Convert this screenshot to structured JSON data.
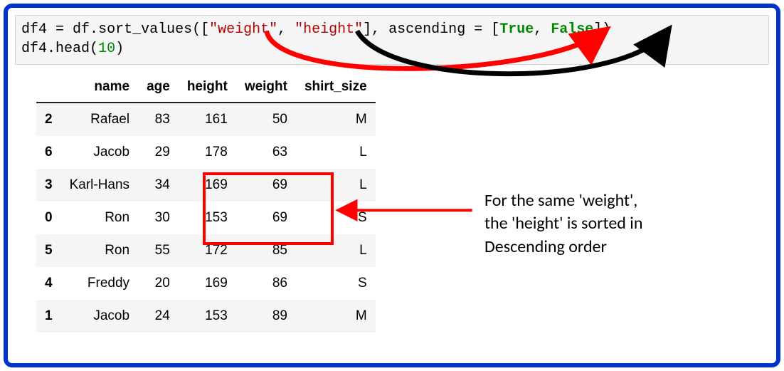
{
  "code": {
    "var": "df4",
    "obj": "df",
    "method": "sort_values",
    "arg1": "\"weight\"",
    "arg2": "\"height\"",
    "kw": "ascending",
    "bool1": "True",
    "bool2": "False",
    "line2_obj": "df4",
    "line2_method": "head",
    "line2_arg": "10"
  },
  "table": {
    "headers": {
      "name": "name",
      "age": "age",
      "height": "height",
      "weight": "weight",
      "shirt_size": "shirt_size"
    },
    "rows": [
      {
        "idx": "2",
        "name": "Rafael",
        "age": "83",
        "height": "161",
        "weight": "50",
        "shirt_size": "M"
      },
      {
        "idx": "6",
        "name": "Jacob",
        "age": "29",
        "height": "178",
        "weight": "63",
        "shirt_size": "L"
      },
      {
        "idx": "3",
        "name": "Karl-Hans",
        "age": "34",
        "height": "169",
        "weight": "69",
        "shirt_size": "L"
      },
      {
        "idx": "0",
        "name": "Ron",
        "age": "30",
        "height": "153",
        "weight": "69",
        "shirt_size": "S"
      },
      {
        "idx": "5",
        "name": "Ron",
        "age": "55",
        "height": "172",
        "weight": "85",
        "shirt_size": "L"
      },
      {
        "idx": "4",
        "name": "Freddy",
        "age": "20",
        "height": "169",
        "weight": "86",
        "shirt_size": "S"
      },
      {
        "idx": "1",
        "name": "Jacob",
        "age": "24",
        "height": "153",
        "weight": "89",
        "shirt_size": "M"
      }
    ]
  },
  "annotation": {
    "line1": "For the same 'weight',",
    "line2": "the 'height' is sorted in",
    "line3": "Descending order"
  },
  "arrows": {
    "red_curve": "weight→True",
    "black_curve": "height→False",
    "red_straight": "highlight→annotation"
  }
}
